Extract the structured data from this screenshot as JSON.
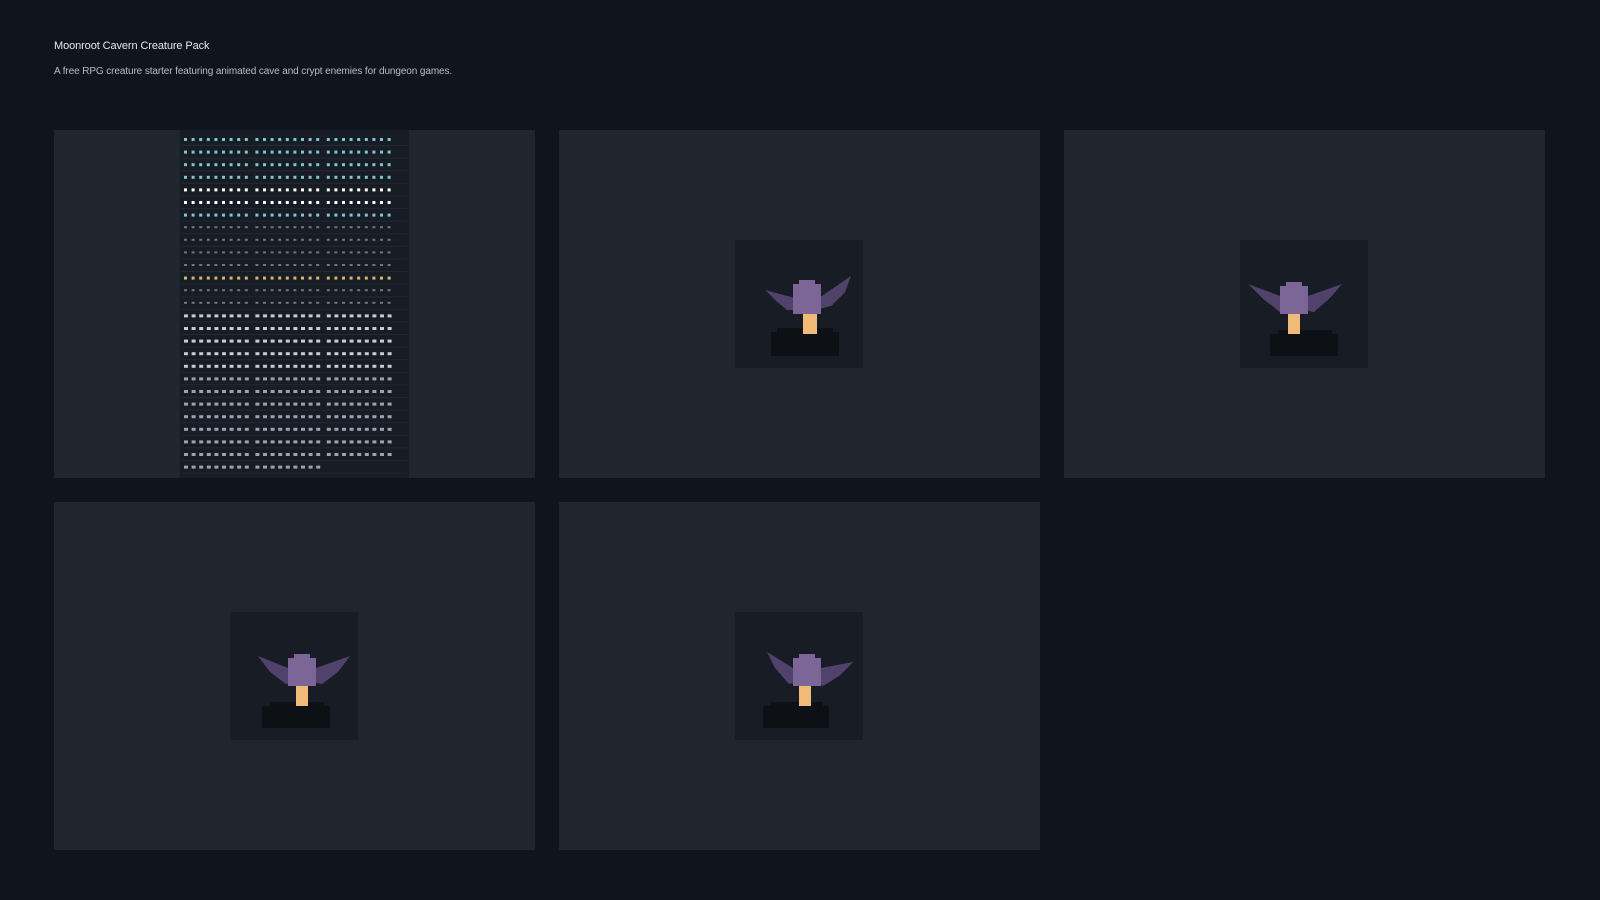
{
  "header": {
    "title": "Moonroot Cavern Creature Pack",
    "subtitle": "A free RPG creature starter featuring animated cave and crypt enemies for dungeon games."
  },
  "gallery": {
    "items": [
      {
        "kind": "sprite-sheet",
        "icon": "sprite-sheet-thumbnail"
      },
      {
        "kind": "sprite-frame",
        "icon": "cave-bat-creature-sprite",
        "pose": "wings-up"
      },
      {
        "kind": "sprite-frame",
        "icon": "cave-bat-creature-sprite",
        "pose": "wings-up"
      },
      {
        "kind": "sprite-frame",
        "icon": "cave-bat-creature-sprite",
        "pose": "wings-level"
      },
      {
        "kind": "sprite-frame",
        "icon": "cave-bat-creature-sprite",
        "pose": "wings-tilted"
      }
    ]
  },
  "colors": {
    "background": "#10141c",
    "card": "#20262e",
    "sprite_bg": "#181c24",
    "creature_head": "#7b6697",
    "creature_wing": "#51426b",
    "creature_stem": "#f0bb78",
    "shadow": "#0d1014",
    "sheet_row_colors": [
      "#7cc7d6",
      "#ffffff",
      "#6f7785",
      "#d9b56a",
      "#c7ccd4",
      "#9aa3af"
    ]
  }
}
